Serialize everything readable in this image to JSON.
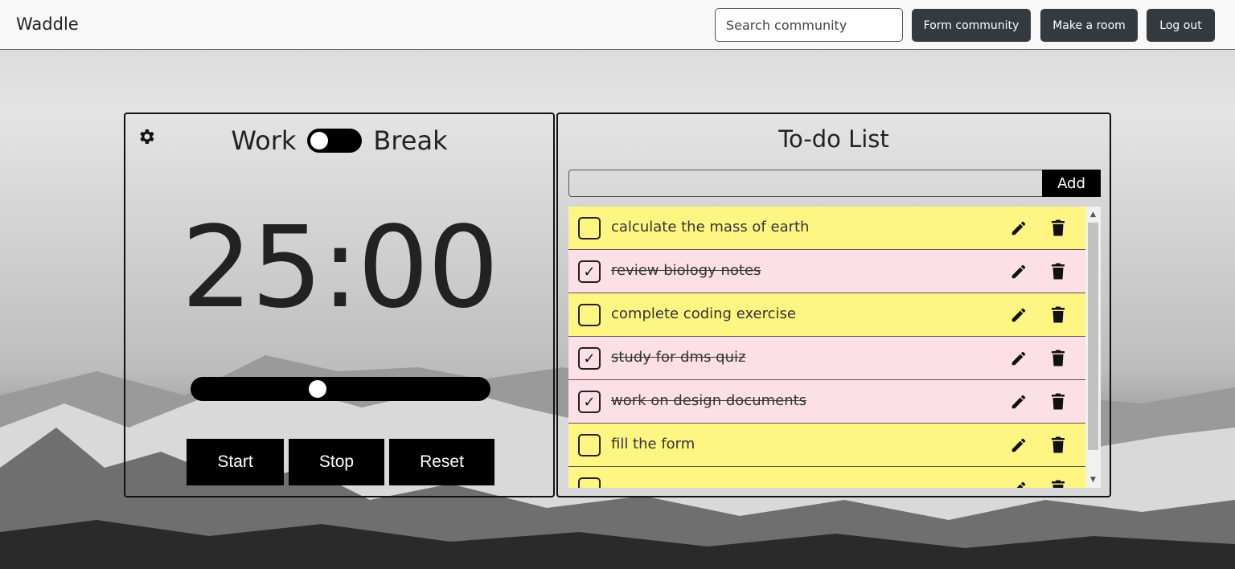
{
  "navbar": {
    "brand": "Waddle",
    "search_placeholder": "Search community",
    "form_community": "Form community",
    "make_room": "Make a room",
    "log_out": "Log out"
  },
  "timer": {
    "work_label": "Work",
    "break_label": "Break",
    "mode_is_break": false,
    "time": "25:00",
    "slider_value": 0.42,
    "start": "Start",
    "stop": "Stop",
    "reset": "Reset"
  },
  "todo": {
    "title": "To-do List",
    "input_value": "",
    "add_label": "Add",
    "items": [
      {
        "text": "calculate the mass of earth",
        "done": false
      },
      {
        "text": "review biology notes",
        "done": true
      },
      {
        "text": "complete coding exercise",
        "done": false
      },
      {
        "text": "study for dms quiz",
        "done": true
      },
      {
        "text": "work on design documents",
        "done": true
      },
      {
        "text": "fill the form",
        "done": false
      },
      {
        "text": "",
        "done": false
      }
    ]
  },
  "colors": {
    "todo_item": "#fff582",
    "done_item": "#fce0e6",
    "nav_button": "#333a40"
  },
  "icons": {
    "settings": "gear-icon",
    "edit": "pencil-icon",
    "delete": "trash-icon",
    "check": "check-icon"
  }
}
